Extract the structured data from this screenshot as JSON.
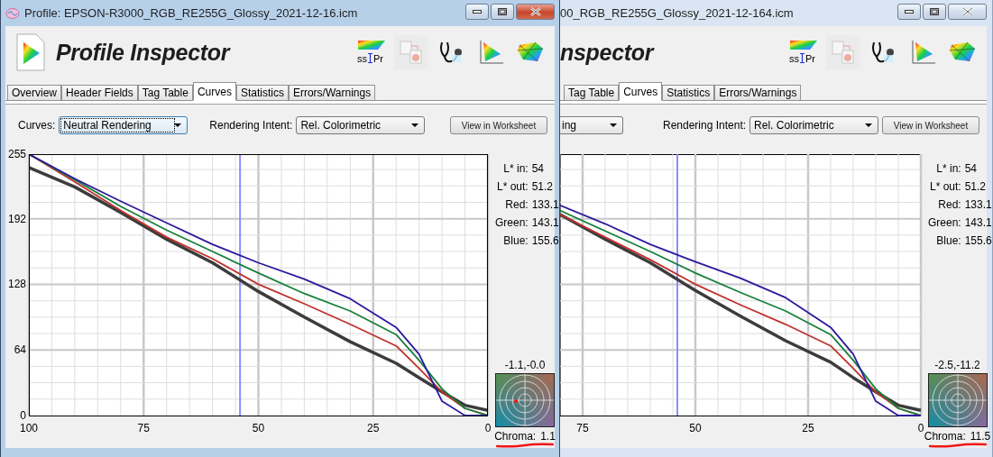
{
  "windows": [
    {
      "kind": "full",
      "active": true,
      "title": "Profile: EPSON-R3000_RGB_RE255G_Glossy_2021-12-16.icm",
      "heading": "Profile Inspector",
      "toolbar": [
        {
          "kind": "spectrum-text",
          "left": "ss",
          "right": "Pr",
          "disabled": false
        },
        {
          "kind": "export",
          "disabled": true
        },
        {
          "kind": "stethoscope",
          "disabled": false
        },
        {
          "kind": "gamut-2d",
          "disabled": false
        },
        {
          "kind": "gamut-3d",
          "disabled": false
        }
      ],
      "tabs": [
        {
          "label": "Overview",
          "selected": false
        },
        {
          "label": "Header Fields",
          "selected": false
        },
        {
          "label": "Tag Table",
          "selected": false
        },
        {
          "label": "Curves",
          "selected": true
        },
        {
          "label": "Statistics",
          "selected": false
        },
        {
          "label": "Errors/Warnings",
          "selected": false
        }
      ],
      "curves_label": "Curves:",
      "curves_select": {
        "value": "Neutral Rendering",
        "focused": true
      },
      "intent_label": "Rendering Intent:",
      "intent_select": {
        "value": "Rel. Colorimetric",
        "focused": false
      },
      "worksheet_button": "View in Worksheet",
      "chart_data": {
        "type": "line",
        "x": [
          100,
          90,
          80,
          70,
          60,
          50,
          40,
          30,
          20,
          15,
          10,
          5,
          0
        ],
        "series": [
          {
            "color": "#3c3c3c",
            "values": [
              242,
              223,
              198,
              172,
              149,
              121,
              96,
              72,
              51,
              37,
              23,
              10,
              5
            ]
          },
          {
            "color": "#c0302a",
            "values": [
              255,
              228,
              200,
              174,
              153,
              128,
              109,
              89,
              68,
              46,
              23,
              7,
              0
            ]
          },
          {
            "color": "#17803c",
            "values": [
              255,
              230,
              204,
              181,
              160,
              139,
              119,
              102,
              79,
              54,
              26,
              7,
              0
            ]
          },
          {
            "color": "#2c1a9c",
            "values": [
              255,
              231,
              209,
              188,
              167,
              149,
              133,
              114,
              86,
              60,
              14,
              0,
              0
            ]
          }
        ],
        "xlim": [
          100,
          0
        ],
        "ylim": [
          0,
          255
        ],
        "xticks": [
          100,
          75,
          50,
          25,
          0
        ],
        "yticks": [
          0,
          64,
          128,
          192,
          255
        ],
        "grid": true,
        "ref_lines": [
          {
            "axis": "x",
            "value": 54
          }
        ]
      },
      "readouts": [
        {
          "label": "L* in:",
          "value": "54"
        },
        {
          "label": "L* out:",
          "value": "51.2"
        },
        {
          "label": "Red:",
          "value": "133.1"
        },
        {
          "label": "Green:",
          "value": "143.1"
        },
        {
          "label": "Blue:",
          "value": "155.6"
        }
      ],
      "chroma": {
        "ab": "-1.1,-0.0",
        "label": "Chroma:",
        "value": "1.1",
        "marker": true
      }
    },
    {
      "kind": "clipped",
      "active": false,
      "title": "00_RGB_RE255G_Glossy_2021-12-164.icm",
      "heading": "nspector",
      "toolbar": [
        {
          "kind": "spectrum-text",
          "left": "ss",
          "right": "Pr",
          "disabled": false
        },
        {
          "kind": "export",
          "disabled": true
        },
        {
          "kind": "stethoscope",
          "disabled": false
        },
        {
          "kind": "gamut-2d",
          "disabled": false
        },
        {
          "kind": "gamut-3d",
          "disabled": false
        }
      ],
      "tabs": [
        {
          "label": "Tag Table",
          "selected": false
        },
        {
          "label": "Curves",
          "selected": true
        },
        {
          "label": "Statistics",
          "selected": false
        },
        {
          "label": "Errors/Warnings",
          "selected": false
        }
      ],
      "curves_select": {
        "value": "ing",
        "focused": false
      },
      "intent_label": "Rendering Intent:",
      "intent_select": {
        "value": "Rel. Colorimetric",
        "focused": false
      },
      "worksheet_button": "View in Worksheet",
      "plot": {
        "x_labels": [
          "75",
          "50",
          "25",
          "0"
        ]
      },
      "readouts": [
        {
          "label": "L* in:",
          "value": "54"
        },
        {
          "label": "L* out:",
          "value": "51.2"
        },
        {
          "label": "Red:",
          "value": "133.1"
        },
        {
          "label": "Green:",
          "value": "143.1"
        },
        {
          "label": "Blue:",
          "value": "155.6"
        }
      ],
      "chroma": {
        "ab": "-2.5,-11.2",
        "label": "Chroma:",
        "value": "11.5",
        "marker": false
      }
    }
  ]
}
